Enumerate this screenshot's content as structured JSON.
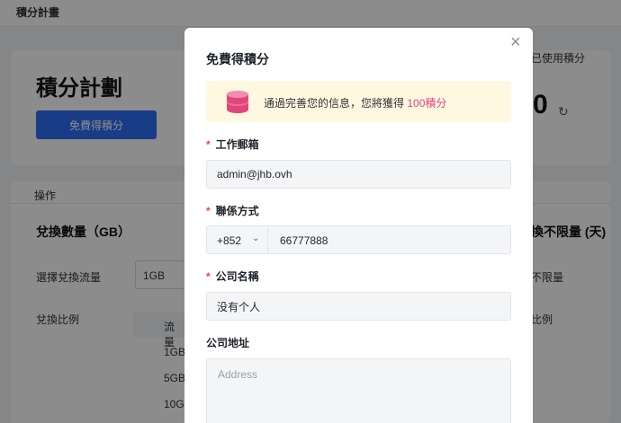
{
  "breadcrumb": "積分計畫",
  "hero": {
    "title": "積分計劃",
    "free_button": "免費得積分",
    "used_label": "已使用積分",
    "used_value": "0",
    "refresh_icon": "refresh-icon"
  },
  "operations": {
    "label": "操作",
    "exchange_title": "兌換數量（GB）",
    "unlimited_title": "換不限量 (天)",
    "select_label": "選擇兌換流量",
    "select_value": "1GB",
    "unlimited_value": "不限量",
    "ratio_label": "兌換比例",
    "ratio_right": "比例",
    "table_header": "流量",
    "table_rows": [
      "1GB",
      "5GB",
      "10G"
    ]
  },
  "modal": {
    "title": "免費得積分",
    "close_icon": "close-icon",
    "notice": {
      "icon": "coins-icon",
      "text": "通過完善您的信息，您將獲得",
      "points": "100積分"
    },
    "email": {
      "label": "工作郵箱",
      "required": "*",
      "value": "admin@jhb.ovh"
    },
    "contact": {
      "label": "聯係方式",
      "required": "*",
      "country_code": "+852",
      "chevron_icon": "chevron-down-icon",
      "phone": "66777888"
    },
    "company": {
      "label": "公司名稱",
      "required": "*",
      "value": "没有个人"
    },
    "address": {
      "label": "公司地址",
      "placeholder": "Address"
    }
  },
  "colors": {
    "accent": "#2f6df6",
    "required": "#e5484d",
    "points": "#e0467c",
    "notice_bg": "#fff8e1"
  }
}
